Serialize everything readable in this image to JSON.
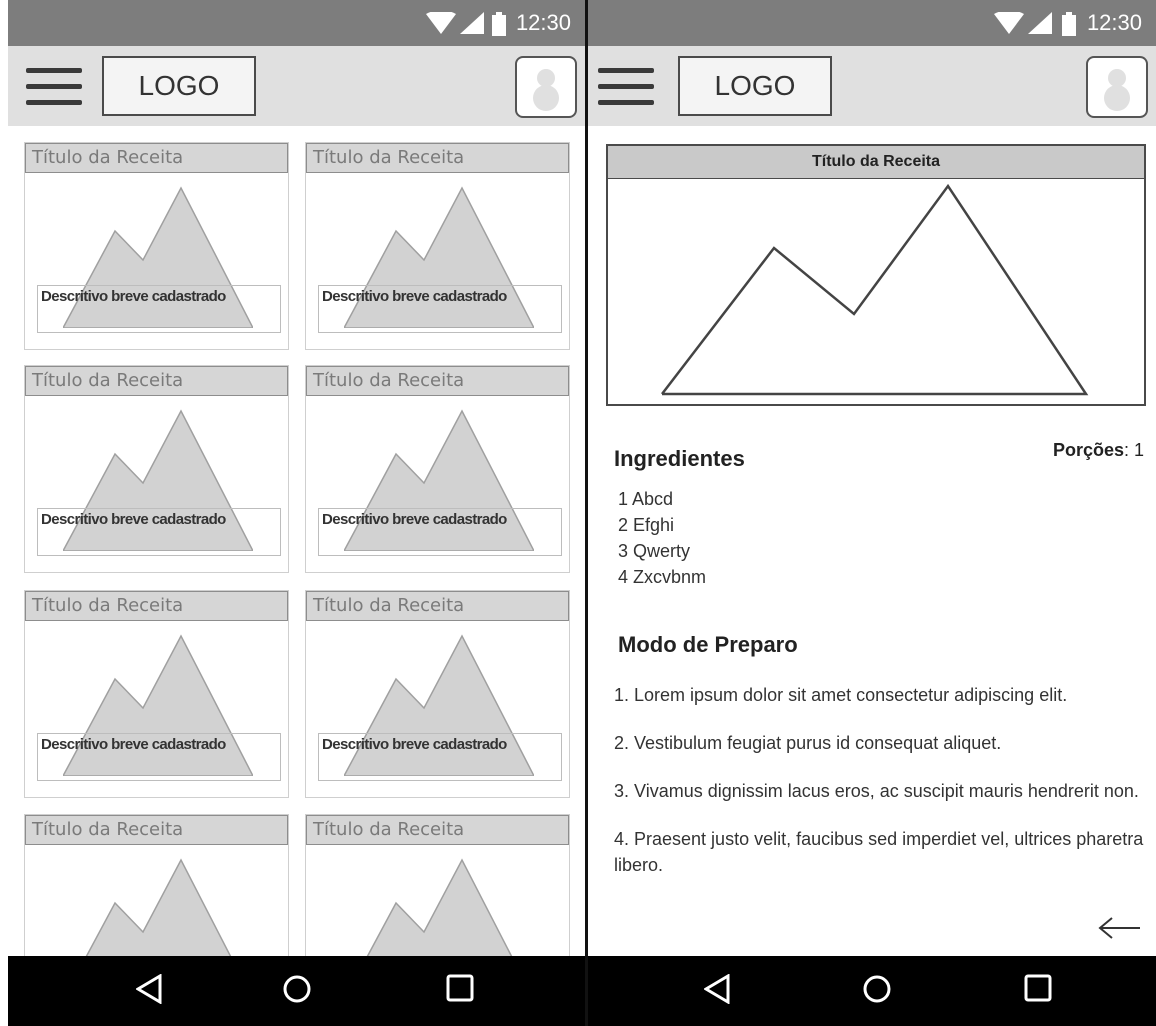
{
  "status": {
    "time": "12:30"
  },
  "appbar": {
    "logo": "LOGO"
  },
  "grid": {
    "cards": [
      {
        "title": "Título da Receita",
        "desc": "Descritivo breve cadastrado"
      },
      {
        "title": "Título da Receita",
        "desc": "Descritivo breve cadastrado"
      },
      {
        "title": "Título da Receita",
        "desc": "Descritivo breve cadastrado"
      },
      {
        "title": "Título da Receita",
        "desc": "Descritivo breve cadastrado"
      },
      {
        "title": "Título da Receita",
        "desc": "Descritivo breve cadastrado"
      },
      {
        "title": "Título da Receita",
        "desc": "Descritivo breve cadastrado"
      },
      {
        "title": "Título da Receita",
        "desc": ""
      },
      {
        "title": "Título da Receita",
        "desc": ""
      }
    ]
  },
  "detail": {
    "title": "Título da Receita",
    "ingredients_heading": "Ingredientes",
    "portions_label": "Porções",
    "portions_value": ": 1",
    "ingredients": [
      "1 Abcd",
      "2 Efghi",
      "3 Qwerty",
      "4 Zxcvbnm"
    ],
    "prep_heading": "Modo de Preparo",
    "steps": [
      "1. Lorem ipsum dolor sit amet consectetur adipiscing elit.",
      "2. Vestibulum feugiat purus id consequat aliquet.",
      "3. Vivamus dignissim lacus eros, ac suscipit mauris hendrerit non.",
      "4. Praesent justo velit, faucibus sed imperdiet vel, ultrices pharetra libero."
    ]
  },
  "icons": {
    "status": [
      "wifi-icon",
      "signal-icon",
      "battery-icon"
    ],
    "appbar": [
      "menu-icon",
      "avatar-icon"
    ],
    "nav": [
      "back-triangle-icon",
      "home-circle-icon",
      "recents-square-icon"
    ],
    "detail": [
      "back-arrow-icon"
    ]
  }
}
